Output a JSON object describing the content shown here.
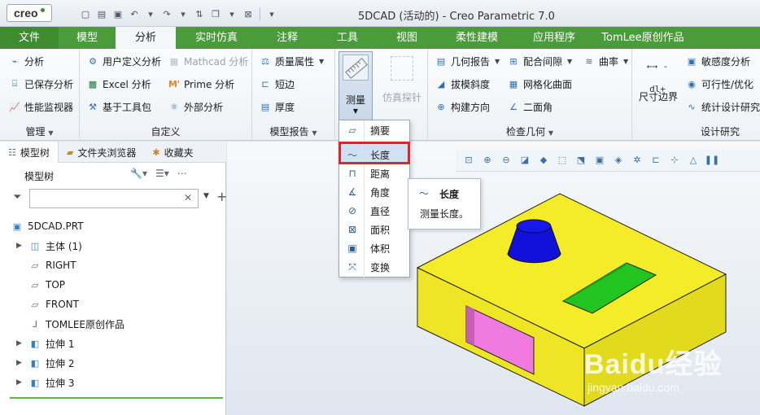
{
  "logo": "creo",
  "window_title": "5DCAD (活动的) - Creo Parametric 7.0",
  "tabs": [
    "文件",
    "模型",
    "分析",
    "实时仿真",
    "注释",
    "工具",
    "视图",
    "柔性建模",
    "应用程序",
    "TomLee原创作品"
  ],
  "active_tab": "分析",
  "ribbon": {
    "manage": {
      "label": "管理",
      "items": [
        "分析",
        "已保存分析",
        "性能监视器"
      ]
    },
    "custom": {
      "label": "自定义",
      "items": [
        "用户定义分析",
        "Mathcad 分析",
        "Excel 分析",
        "Prime 分析",
        "基于工具包",
        "外部分析"
      ]
    },
    "model_report": {
      "label": "模型报告",
      "items": [
        "质量属性",
        "短边",
        "厚度"
      ]
    },
    "measure": {
      "label": "测量"
    },
    "sim_probe": {
      "label": "仿真探针"
    },
    "inspect": {
      "label": "检查几何",
      "items": [
        "几何报告",
        "配合间隙",
        "曲率",
        "拔模斜度",
        "网格化曲面",
        "构建方向",
        "二面角"
      ]
    },
    "size_bound": {
      "label": "尺寸边界",
      "glyph": "←→ -dl+"
    },
    "design_study": {
      "label": "设计研究",
      "items": [
        "敏感度分析",
        "可行性/优化",
        "统计设计研究"
      ]
    }
  },
  "left_panel": {
    "tabs": [
      "模型树",
      "文件夹浏览器",
      "收藏夹"
    ],
    "tree_title": "模型树",
    "search_value": "",
    "tree": [
      {
        "label": "5DCAD.PRT",
        "icon": "part-icon",
        "expandable": false,
        "indent": 0
      },
      {
        "label": "主体 (1)",
        "icon": "body-icon",
        "expandable": true,
        "indent": 1
      },
      {
        "label": "RIGHT",
        "icon": "datum-plane-icon",
        "expandable": false,
        "indent": 1
      },
      {
        "label": "TOP",
        "icon": "datum-plane-icon",
        "expandable": false,
        "indent": 1
      },
      {
        "label": "FRONT",
        "icon": "datum-plane-icon",
        "expandable": false,
        "indent": 1
      },
      {
        "label": "TOMLEE原创作品",
        "icon": "coordinate-system-icon",
        "expandable": false,
        "indent": 1
      },
      {
        "label": "拉伸 1",
        "icon": "extrude-icon",
        "expandable": true,
        "indent": 1
      },
      {
        "label": "拉伸 2",
        "icon": "extrude-icon",
        "expandable": true,
        "indent": 1
      },
      {
        "label": "拉伸 3",
        "icon": "extrude-icon",
        "expandable": true,
        "indent": 1
      }
    ]
  },
  "measure_menu": {
    "items": [
      "摘要",
      "长度",
      "距离",
      "角度",
      "直径",
      "面积",
      "体积",
      "变换"
    ],
    "highlighted": "长度"
  },
  "tooltip": {
    "title": "长度",
    "description": "测量长度。"
  },
  "watermark": {
    "main": "Baidu经验",
    "sub": "jingyan.baidu.com"
  },
  "colors": {
    "accent_green": "#4a9b3a",
    "model_yellow": "#f4ec28",
    "boss_blue": "#1010d8",
    "cut_green": "#22c41f",
    "cut_pink": "#f07ae0",
    "highlight_red": "#d8262b"
  }
}
